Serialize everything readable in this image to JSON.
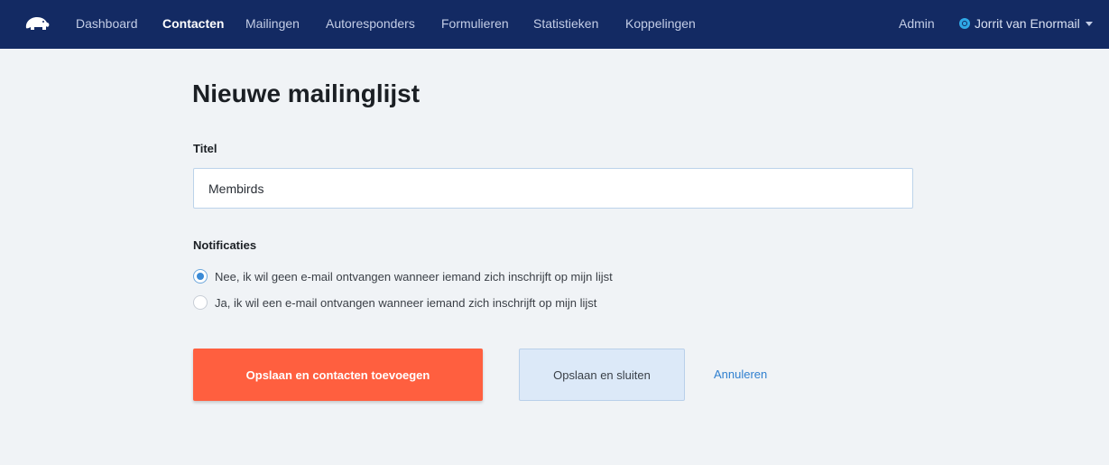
{
  "nav": {
    "items": [
      {
        "label": "Dashboard"
      },
      {
        "label": "Contacten"
      },
      {
        "label": "Mailingen"
      },
      {
        "label": "Autoresponders"
      },
      {
        "label": "Formulieren"
      },
      {
        "label": "Statistieken"
      },
      {
        "label": "Koppelingen"
      }
    ],
    "active_item": "Contacten",
    "admin_label": "Admin",
    "user_name": "Jorrit van Enormail"
  },
  "page": {
    "title": "Nieuwe mailinglijst"
  },
  "form": {
    "title_label": "Titel",
    "title_value": "Membirds",
    "notifications_label": "Notificaties",
    "options": [
      {
        "label": "Nee, ik wil geen e-mail ontvangen wanneer iemand zich inschrijft op mijn lijst",
        "checked": true
      },
      {
        "label": "Ja, ik wil een e-mail ontvangen wanneer iemand zich inschrijft op mijn lijst",
        "checked": false
      }
    ]
  },
  "actions": {
    "primary_label": "Opslaan en contacten toevoegen",
    "secondary_label": "Opslaan en sluiten",
    "cancel_label": "Annuleren"
  },
  "colors": {
    "nav_bg": "#132a63",
    "page_bg": "#f0f3f6",
    "primary_button": "#ff5f3f",
    "secondary_button": "#dce9f8",
    "link": "#2f7fcf",
    "radio_checked": "#3a8ad6"
  },
  "icons": {
    "logo": "elephant-logo-icon",
    "user": "power-icon",
    "dropdown": "caret-down-icon"
  }
}
